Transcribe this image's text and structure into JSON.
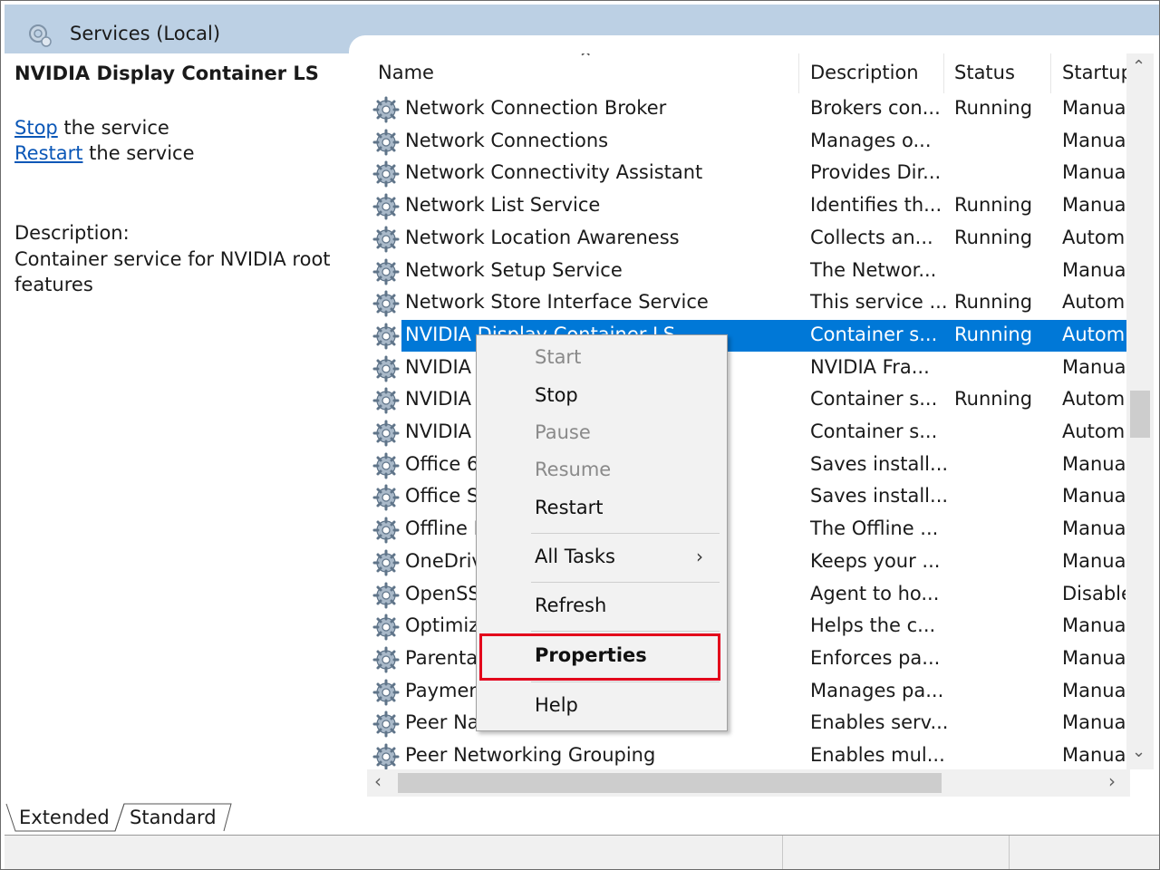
{
  "header": {
    "title": "Services (Local)"
  },
  "left_pane": {
    "service_name": "NVIDIA Display Container LS",
    "actions": [
      {
        "link": "Stop",
        "rest": " the service"
      },
      {
        "link": "Restart",
        "rest": " the service"
      }
    ],
    "description_label": "Description:",
    "description_text": "Container service for NVIDIA root features"
  },
  "table": {
    "columns": [
      "Name",
      "Description",
      "Status",
      "Startup"
    ],
    "rows": [
      {
        "name": "Network Connection Broker",
        "desc": "Brokers con...",
        "status": "Running",
        "startup": "Manual"
      },
      {
        "name": "Network Connections",
        "desc": "Manages o...",
        "status": "",
        "startup": "Manual"
      },
      {
        "name": "Network Connectivity Assistant",
        "desc": "Provides Dir...",
        "status": "",
        "startup": "Manual"
      },
      {
        "name": "Network List Service",
        "desc": "Identifies th...",
        "status": "Running",
        "startup": "Manual"
      },
      {
        "name": "Network Location Awareness",
        "desc": "Collects an...",
        "status": "Running",
        "startup": "Automatic"
      },
      {
        "name": "Network Setup Service",
        "desc": "The Networ...",
        "status": "",
        "startup": "Manual"
      },
      {
        "name": "Network Store Interface Service",
        "desc": "This service ...",
        "status": "Running",
        "startup": "Automatic"
      },
      {
        "name": "NVIDIA Display Container LS",
        "desc": "Container s...",
        "status": "Running",
        "startup": "Automatic",
        "selected": true
      },
      {
        "name": "NVIDIA",
        "desc": "NVIDIA Fra...",
        "status": "",
        "startup": "Manual"
      },
      {
        "name": "NVIDIA",
        "desc": "Container s...",
        "status": "Running",
        "startup": "Automatic"
      },
      {
        "name": "NVIDIA",
        "desc": "Container s...",
        "status": "",
        "startup": "Automatic"
      },
      {
        "name": "Office 6",
        "desc": "Saves install...",
        "status": "",
        "startup": "Manual"
      },
      {
        "name": "Office S",
        "desc": "Saves install...",
        "status": "",
        "startup": "Manual"
      },
      {
        "name": "Offline I",
        "desc": "The Offline ...",
        "status": "",
        "startup": "Manual"
      },
      {
        "name": "OneDriv",
        "desc": "Keeps your ...",
        "status": "",
        "startup": "Manual"
      },
      {
        "name": "OpenSS",
        "desc": "Agent to ho...",
        "status": "",
        "startup": "Disabled"
      },
      {
        "name": "Optimiz",
        "desc": "Helps the c...",
        "status": "",
        "startup": "Manual"
      },
      {
        "name": "Parenta",
        "desc": "Enforces pa...",
        "status": "",
        "startup": "Manual"
      },
      {
        "name": "Paymen",
        "desc": "Manages pa...",
        "status": "",
        "startup": "Manual"
      },
      {
        "name": "Peer Na",
        "desc": "Enables serv...",
        "status": "",
        "startup": "Manual"
      },
      {
        "name": "Peer Networking Grouping",
        "desc": "Enables mul...",
        "status": "",
        "startup": "Manual"
      }
    ]
  },
  "context_menu": {
    "items": [
      {
        "label": "Start",
        "disabled": true
      },
      {
        "label": "Stop",
        "disabled": false
      },
      {
        "label": "Pause",
        "disabled": true
      },
      {
        "label": "Resume",
        "disabled": true
      },
      {
        "label": "Restart",
        "disabled": false
      },
      {
        "label": "All Tasks",
        "disabled": false,
        "submenu": true
      },
      {
        "label": "Refresh",
        "disabled": false
      },
      {
        "label": "Properties",
        "disabled": false,
        "bold": true,
        "highlighted": true
      },
      {
        "label": "Help",
        "disabled": false
      }
    ]
  },
  "tabs": [
    "Extended",
    "Standard"
  ],
  "colors": {
    "selection": "#0078d7",
    "highlight_box": "#e3001b",
    "link": "#0b57b7",
    "header": "#bcd0e4"
  }
}
